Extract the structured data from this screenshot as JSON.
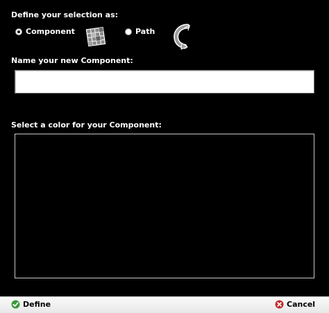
{
  "selection": {
    "heading": "Define your selection as:",
    "options": [
      {
        "label": "Component",
        "icon": "component-grid-icon",
        "selected": true
      },
      {
        "label": "Path",
        "icon": "path-curve-icon",
        "selected": false
      }
    ]
  },
  "name_field": {
    "label": "Name your new Component:",
    "value": "",
    "placeholder": ""
  },
  "color": {
    "label": "Select a color for your Component:"
  },
  "footer": {
    "define_label": "Define",
    "define_icon": "check-circle-icon",
    "cancel_label": "Cancel",
    "cancel_icon": "x-circle-icon"
  },
  "colors": {
    "background": "#000000",
    "footer_background": "#f0f0f0",
    "define_icon": "#3a9a3a",
    "cancel_icon": "#c03030"
  }
}
